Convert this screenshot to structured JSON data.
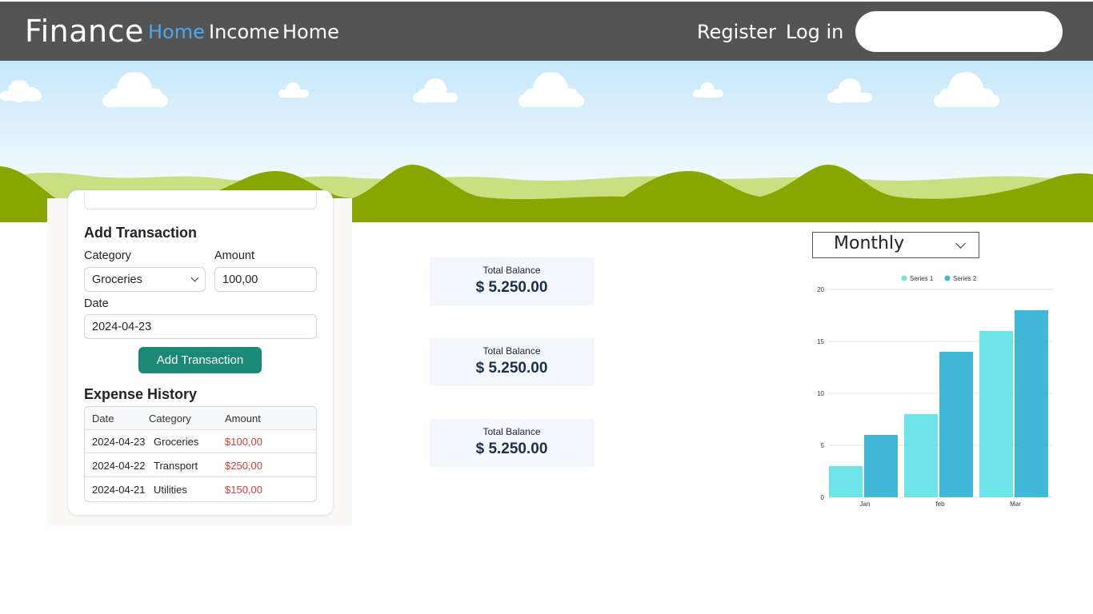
{
  "navbar": {
    "brand": "Finance",
    "links": [
      "Home",
      "Income",
      "Home"
    ],
    "register": "Register",
    "login": "Log in",
    "search_value": ""
  },
  "transaction_form": {
    "title": "Add Transaction",
    "category_label": "Category",
    "category_value": "Groceries",
    "amount_label": "Amount",
    "amount_value": "100,00",
    "date_label": "Date",
    "date_value": "2024-04-23",
    "submit_label": "Add Transaction"
  },
  "expense_history": {
    "title": "Expense History",
    "columns": [
      "Date",
      "Category",
      "Amount"
    ],
    "rows": [
      {
        "date": "2024-04-23",
        "category": "Groceries",
        "amount": "$100,00"
      },
      {
        "date": "2024-04-22",
        "category": "Transport",
        "amount": "$250,00"
      },
      {
        "date": "2024-04-21",
        "category": "Utilities",
        "amount": "$150,00"
      }
    ]
  },
  "balances": [
    {
      "label": "Total Balance",
      "value": "$ 5.250.00"
    },
    {
      "label": "Total Balance",
      "value": "$ 5.250.00"
    },
    {
      "label": "Total Balance",
      "value": "$ 5.250.00"
    }
  ],
  "period_select": {
    "value": "Monthly"
  },
  "colors": {
    "navbar": "#545454",
    "active_link": "#4aa8f0",
    "button": "#1a8a76",
    "expense_amount": "#d63a3a",
    "series_1": "#6ce4e8",
    "series_2": "#41b8d8"
  },
  "chart_data": {
    "type": "bar",
    "categories": [
      "Jan",
      "feb",
      "Mar"
    ],
    "series": [
      {
        "name": "Series 1",
        "values": [
          3,
          8,
          16
        ]
      },
      {
        "name": "Series 2",
        "values": [
          6,
          14,
          18
        ]
      }
    ],
    "ylim": [
      0,
      20
    ],
    "yticks": [
      0,
      5,
      10,
      15,
      20
    ],
    "legend": "top",
    "grid": true
  }
}
